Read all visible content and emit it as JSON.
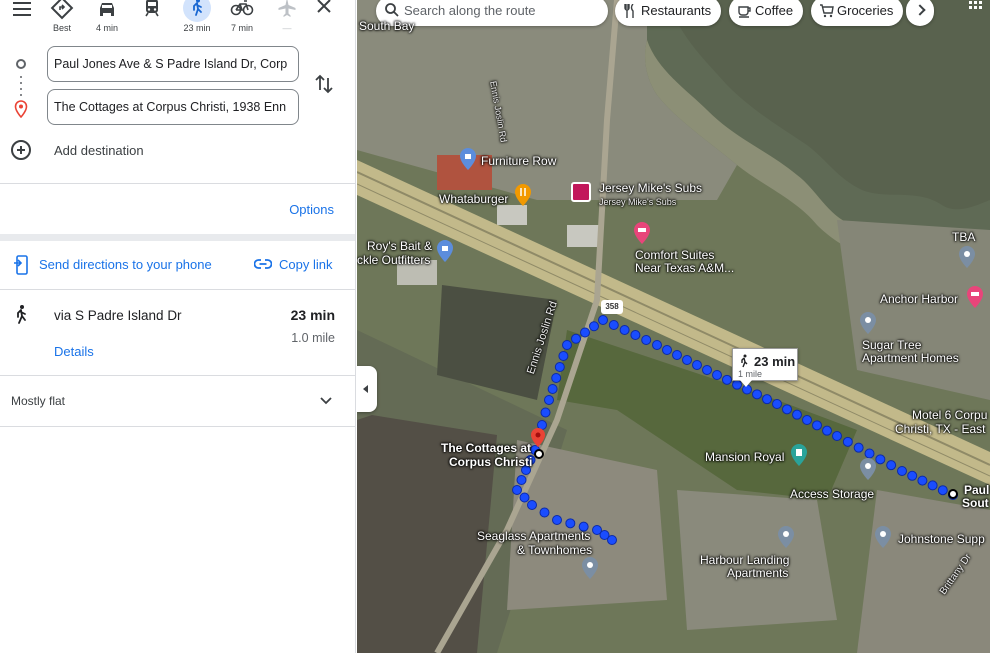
{
  "travel_modes": [
    {
      "name": "best",
      "label": "Best",
      "icon": "diamond-route-icon"
    },
    {
      "name": "drive",
      "label": "4 min",
      "icon": "car-icon"
    },
    {
      "name": "transit",
      "label": "",
      "icon": "train-icon"
    },
    {
      "name": "walk",
      "label": "23 min",
      "icon": "walk-icon",
      "active": true
    },
    {
      "name": "bike",
      "label": "7 min",
      "icon": "bicycle-icon"
    },
    {
      "name": "flight",
      "label": "—",
      "icon": "airplane-icon"
    }
  ],
  "route": {
    "origin": "Paul Jones Ave & S Padre Island Dr, Corp",
    "destination": "The Cottages at Corpus Christi, 1938 Enn",
    "add_destination": "Add destination"
  },
  "options_label": "Options",
  "share": {
    "send_to_phone": "Send directions to your phone",
    "copy_link": "Copy link"
  },
  "route_option": {
    "via": "via S Padre Island Dr",
    "duration": "23 min",
    "distance": "1.0 mile",
    "details": "Details"
  },
  "elevation": {
    "summary": "Mostly flat"
  },
  "map": {
    "search_placeholder": "Search along the route",
    "chips": [
      {
        "label": "Restaurants",
        "icon": "fork-knife-icon"
      },
      {
        "label": "Coffee",
        "icon": "coffee-icon"
      },
      {
        "label": "Groceries",
        "icon": "cart-icon"
      }
    ],
    "callout": {
      "duration": "23 min",
      "distance": "1 mile"
    },
    "highway_shield": "358",
    "labels": {
      "south_bay": "South Bay",
      "ennis_joslin_top": "Ennis Joslin Rd",
      "furniture_row": "Furniture Row",
      "whataburger": "Whataburger",
      "jersey": "Jersey Mike's Subs",
      "jersey_sub": "Jersey Mike's Subs",
      "roys_1": "Roy's Bait &",
      "roys_2": "ckle Outfitters",
      "comfort_1": "Comfort Suites",
      "comfort_2": "Near Texas A&M...",
      "tba": "TBA",
      "anchor": "Anchor Harbor",
      "sugar_1": "Sugar Tree",
      "sugar_2": "Apartment Homes",
      "motel_1": "Motel 6 Corpu",
      "motel_2": "Christi, TX - East",
      "ennis_joslin_mid": "Ennis Joslin Rd",
      "mansion": "Mansion Royal",
      "access": "Access Storage",
      "cottages_1": "The Cottages at",
      "cottages_2": "Corpus Christi",
      "paul_1": "Paul",
      "paul_2": "Sout",
      "seaglass_1": "Seaglass Apartments",
      "seaglass_2": "& Townhomes",
      "harbour_1": "Harbour Landing",
      "harbour_2": "Apartments",
      "johnstone": "Johnstone Supp",
      "brittany": "Brittany Dr"
    }
  },
  "colors": {
    "accent": "#1a73e8",
    "route_dots": "#1a4dff",
    "active_mode_bg": "#d2e3fc",
    "dest_pin": "#ea4335"
  }
}
